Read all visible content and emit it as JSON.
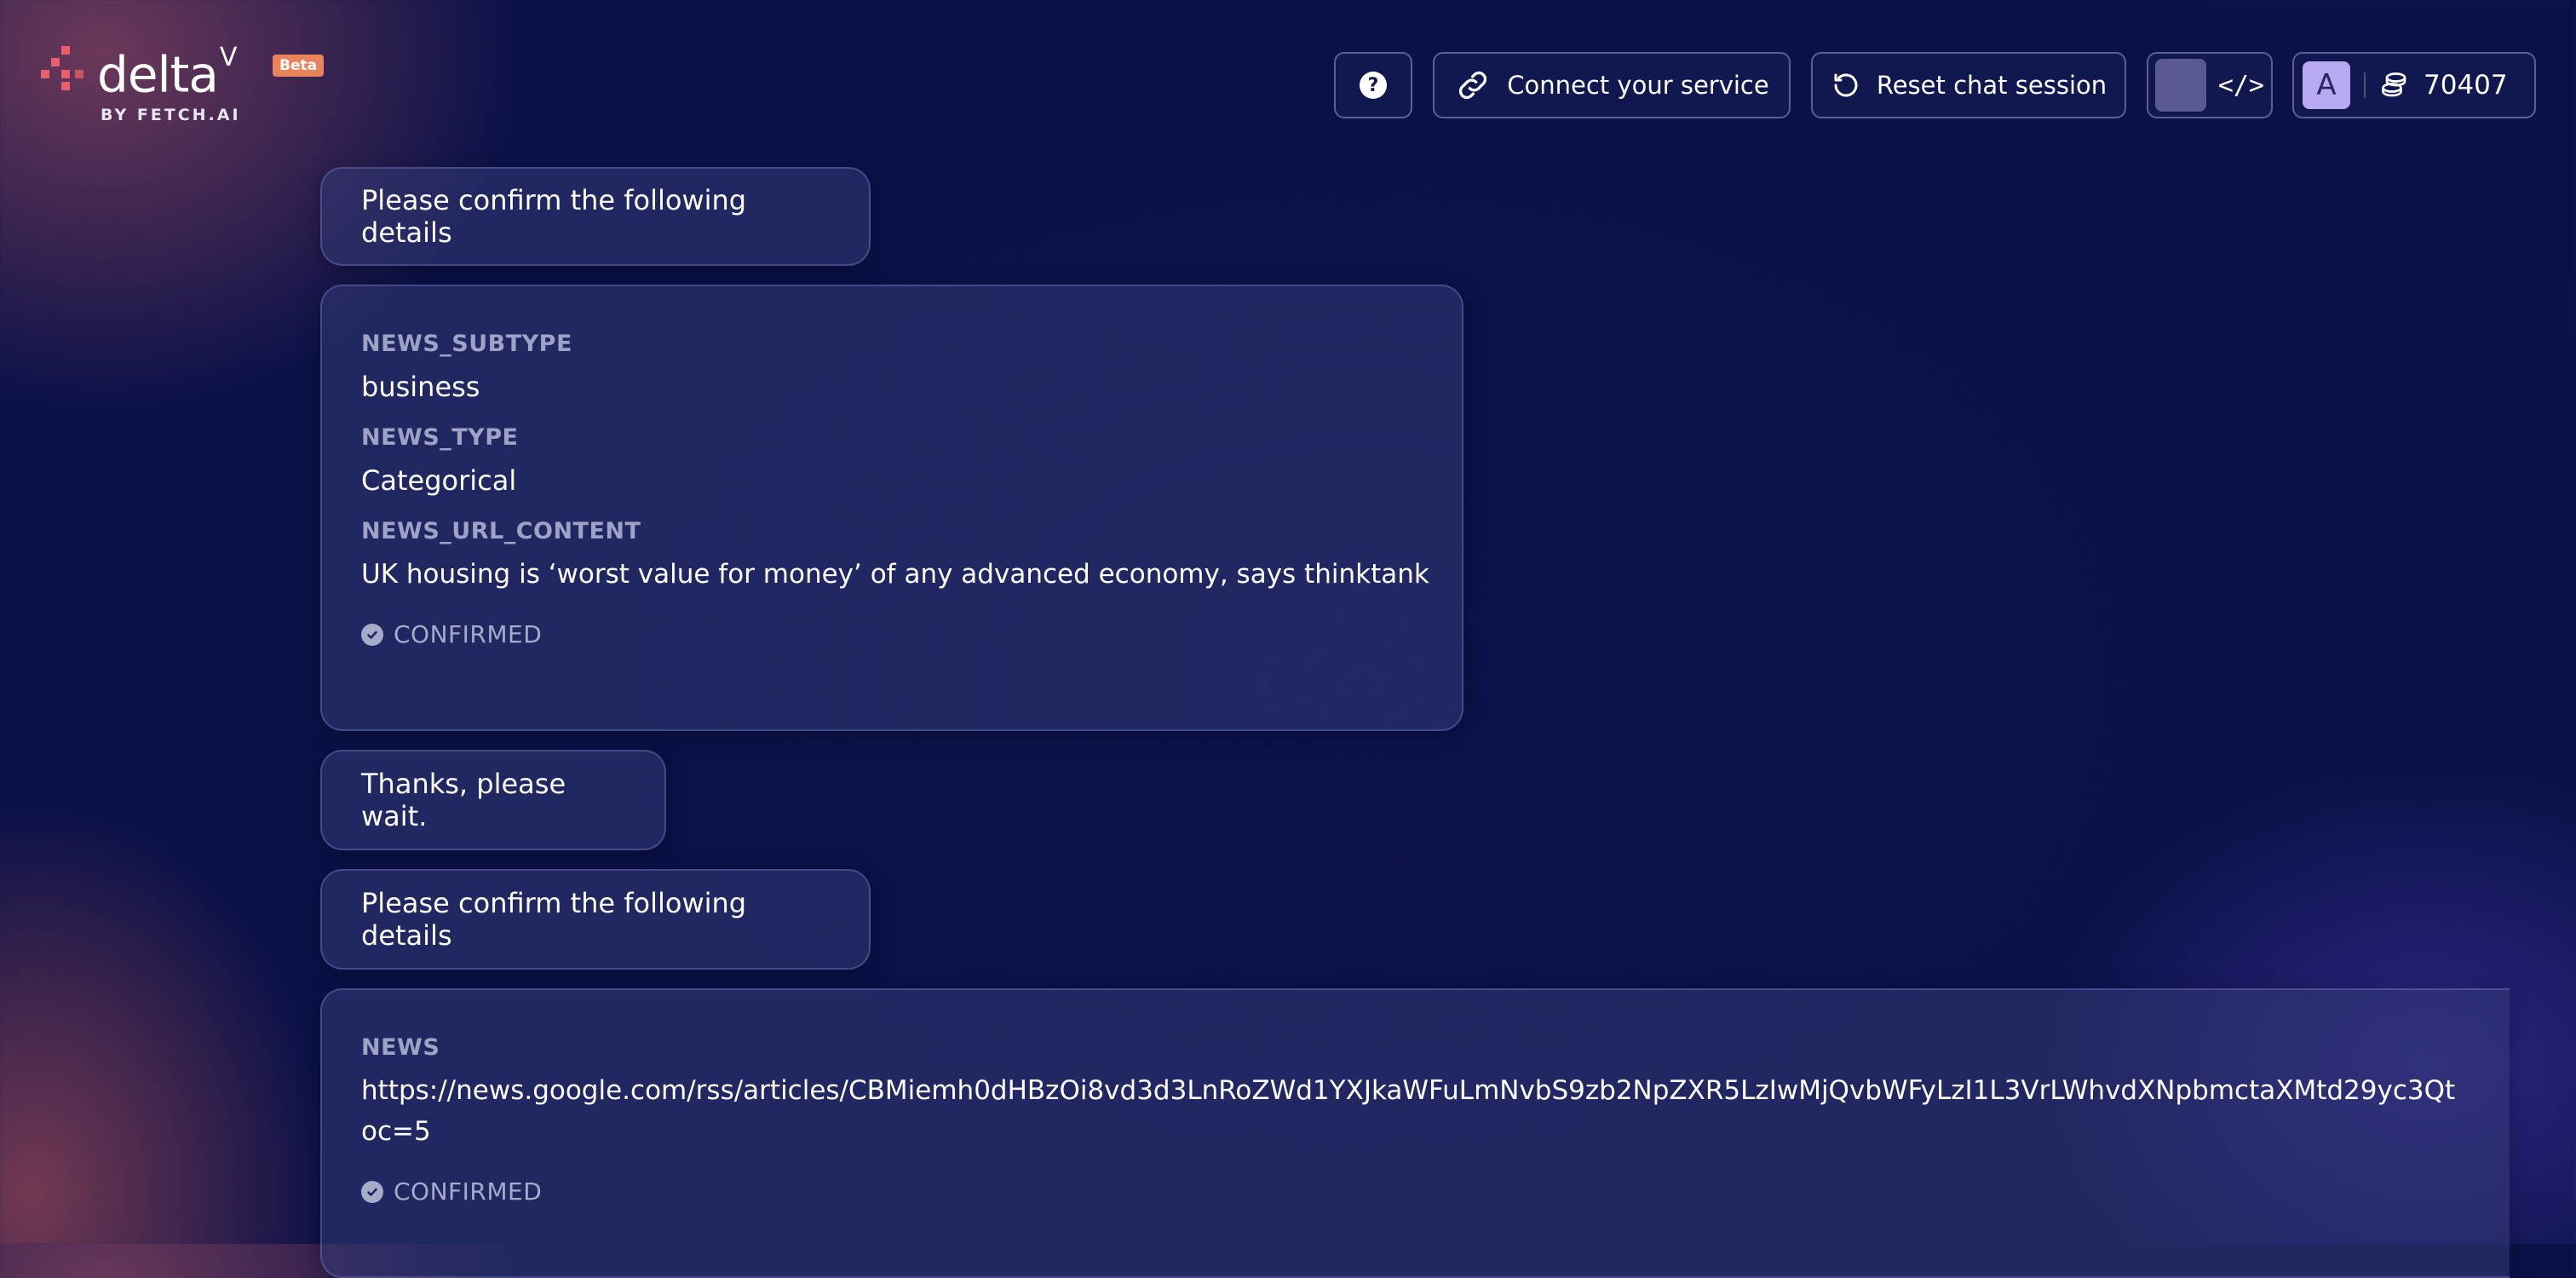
{
  "brand": {
    "name": "delta",
    "superscript": "V",
    "badge": "Beta",
    "byline": "BY FETCH.AI"
  },
  "toolbar": {
    "help_label": "?",
    "connect_label": "Connect your service",
    "reset_label": "Reset chat session",
    "dev_toggle_label": "</>",
    "avatar_initial": "A",
    "credits": "70407"
  },
  "chat": {
    "messages": [
      {
        "type": "text",
        "text": "Please confirm the following details"
      },
      {
        "type": "details",
        "fields": [
          {
            "label": "NEWS_SUBTYPE",
            "value": "business"
          },
          {
            "label": "NEWS_TYPE",
            "value": "Categorical"
          },
          {
            "label": "NEWS_URL_CONTENT",
            "value": "UK housing is ‘worst value for money’ of any advanced economy, says thinktank"
          }
        ],
        "status": "CONFIRMED"
      },
      {
        "type": "text",
        "text": "Thanks, please wait."
      },
      {
        "type": "text",
        "text": "Please confirm the following details"
      },
      {
        "type": "details",
        "fields": [
          {
            "label": "NEWS",
            "value": "https://news.google.com/rss/articles/CBMiemh0dHBzOi8vd3d3LnRoZWd1YXJkaWFuLmNvbS9zb2NpZXR5LzIwMjQvbWFyLzI1L3VrLWhvdXNpbmctaXMtd29yc3Qtoc=5"
          }
        ],
        "status": "CONFIRMED"
      }
    ]
  },
  "colors": {
    "background": "#0b1148",
    "accent": "#e8616a",
    "beta_badge": "#e8835a",
    "avatar": "#b9a8f2"
  }
}
